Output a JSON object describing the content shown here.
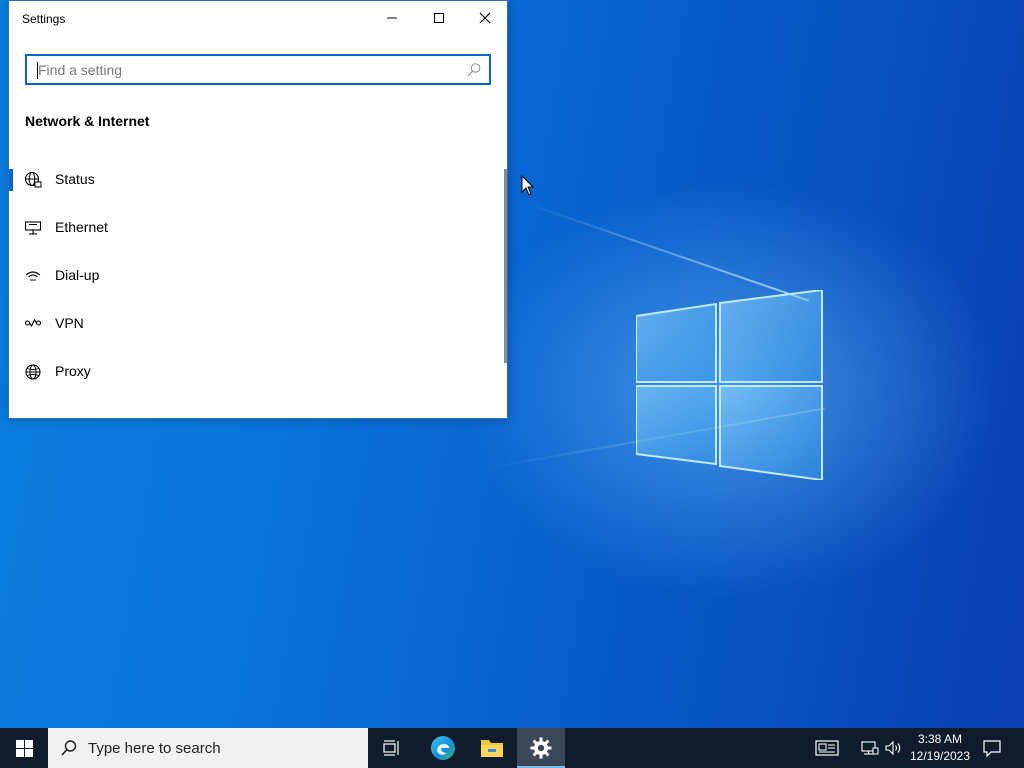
{
  "window": {
    "title": "Settings",
    "search": {
      "placeholder": "Find a setting"
    },
    "section_title": "Network & Internet",
    "nav_items": [
      {
        "label": "Status",
        "icon": "globe-network-icon",
        "selected": true
      },
      {
        "label": "Ethernet",
        "icon": "ethernet-icon",
        "selected": false
      },
      {
        "label": "Dial-up",
        "icon": "dial-up-icon",
        "selected": false
      },
      {
        "label": "VPN",
        "icon": "vpn-icon",
        "selected": false
      },
      {
        "label": "Proxy",
        "icon": "globe-icon",
        "selected": false
      }
    ],
    "controls": [
      "minimize-icon",
      "maximize-icon",
      "close-icon"
    ]
  },
  "taskbar": {
    "search_text": "Type here to search",
    "apps": [
      "task-view-icon",
      "edge-icon",
      "file-explorer-icon",
      "settings-gear-icon"
    ],
    "active_app": "settings-gear-icon",
    "clock": {
      "time": "3:38 AM",
      "date": "12/19/2023"
    },
    "tray": [
      "news-icon",
      "network-icon",
      "volume-icon",
      "action-center-icon"
    ]
  },
  "colors": {
    "accent": "#0a64c4",
    "taskbar": "#101c2c",
    "wallpaper_blue": "#0a74dc"
  }
}
